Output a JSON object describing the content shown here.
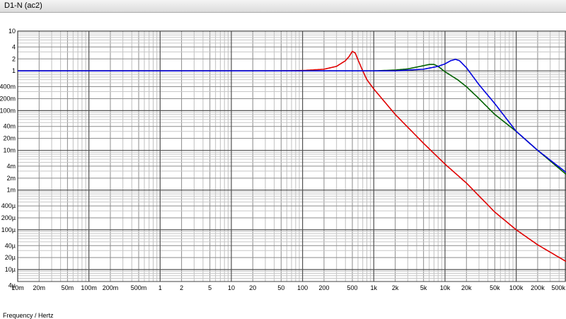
{
  "window": {
    "title": "D1-N (ac2)"
  },
  "chart_data": {
    "type": "line",
    "xlabel": "Frequency / Hertz",
    "ylabel": "",
    "x_scale": "log",
    "y_scale": "log",
    "xlim": [
      0.01,
      500000
    ],
    "ylim": [
      5e-06,
      10
    ],
    "grid": true,
    "x_tick_labels": [
      {
        "v": 0.01,
        "t": "10m"
      },
      {
        "v": 0.02,
        "t": "20m"
      },
      {
        "v": 0.05,
        "t": "50m"
      },
      {
        "v": 0.1,
        "t": "100m"
      },
      {
        "v": 0.2,
        "t": "200m"
      },
      {
        "v": 0.5,
        "t": "500m"
      },
      {
        "v": 1,
        "t": "1"
      },
      {
        "v": 2,
        "t": "2"
      },
      {
        "v": 5,
        "t": "5"
      },
      {
        "v": 10,
        "t": "10"
      },
      {
        "v": 20,
        "t": "20"
      },
      {
        "v": 50,
        "t": "50"
      },
      {
        "v": 100,
        "t": "100"
      },
      {
        "v": 200,
        "t": "200"
      },
      {
        "v": 500,
        "t": "500"
      },
      {
        "v": 1000,
        "t": "1k"
      },
      {
        "v": 2000,
        "t": "2k"
      },
      {
        "v": 5000,
        "t": "5k"
      },
      {
        "v": 10000,
        "t": "10k"
      },
      {
        "v": 20000,
        "t": "20k"
      },
      {
        "v": 50000,
        "t": "50k"
      },
      {
        "v": 100000,
        "t": "100k"
      },
      {
        "v": 200000,
        "t": "200k"
      },
      {
        "v": 500000,
        "t": "500k"
      }
    ],
    "y_tick_labels": [
      {
        "v": 10,
        "t": "10"
      },
      {
        "v": 4,
        "t": "4"
      },
      {
        "v": 2,
        "t": "2"
      },
      {
        "v": 1,
        "t": "1"
      },
      {
        "v": 0.4,
        "t": "400m"
      },
      {
        "v": 0.2,
        "t": "200m"
      },
      {
        "v": 0.1,
        "t": "100m"
      },
      {
        "v": 0.04,
        "t": "40m"
      },
      {
        "v": 0.02,
        "t": "20m"
      },
      {
        "v": 0.01,
        "t": "10m"
      },
      {
        "v": 0.004,
        "t": "4m"
      },
      {
        "v": 0.002,
        "t": "2m"
      },
      {
        "v": 0.001,
        "t": "1m"
      },
      {
        "v": 0.0004,
        "t": "400µ"
      },
      {
        "v": 0.0002,
        "t": "200µ"
      },
      {
        "v": 0.0001,
        "t": "100µ"
      },
      {
        "v": 4e-05,
        "t": "40µ"
      },
      {
        "v": 2e-05,
        "t": "20µ"
      },
      {
        "v": 1e-05,
        "t": "10µ"
      },
      {
        "v": 4e-06,
        "t": "4µ"
      }
    ],
    "series": [
      {
        "color": "#e00000",
        "x": [
          0.01,
          50,
          100,
          200,
          300,
          400,
          450,
          500,
          550,
          600,
          700,
          800,
          1000,
          2000,
          5000,
          10000,
          20000,
          50000,
          100000,
          200000,
          500000
        ],
        "y": [
          1,
          1,
          1.02,
          1.1,
          1.3,
          1.8,
          2.3,
          3.1,
          2.8,
          1.9,
          1.0,
          0.6,
          0.35,
          0.08,
          0.015,
          0.0045,
          0.0015,
          0.00028,
          0.0001,
          4.2e-05,
          1.6e-05
        ]
      },
      {
        "color": "#006000",
        "x": [
          0.01,
          1000,
          2000,
          3000,
          5000,
          6000,
          7000,
          8000,
          10000,
          15000,
          20000,
          30000,
          50000,
          100000,
          200000,
          500000
        ],
        "y": [
          1,
          1,
          1.05,
          1.12,
          1.35,
          1.45,
          1.45,
          1.3,
          0.95,
          0.6,
          0.4,
          0.2,
          0.08,
          0.03,
          0.01,
          0.0025
        ]
      },
      {
        "color": "#0000e0",
        "x": [
          0.01,
          2000,
          5000,
          8000,
          10000,
          12000,
          14000,
          16000,
          20000,
          25000,
          30000,
          50000,
          100000,
          200000,
          500000
        ],
        "y": [
          1,
          1,
          1.1,
          1.3,
          1.5,
          1.8,
          1.95,
          1.8,
          1.2,
          0.7,
          0.45,
          0.15,
          0.03,
          0.01,
          0.0028
        ]
      }
    ]
  }
}
